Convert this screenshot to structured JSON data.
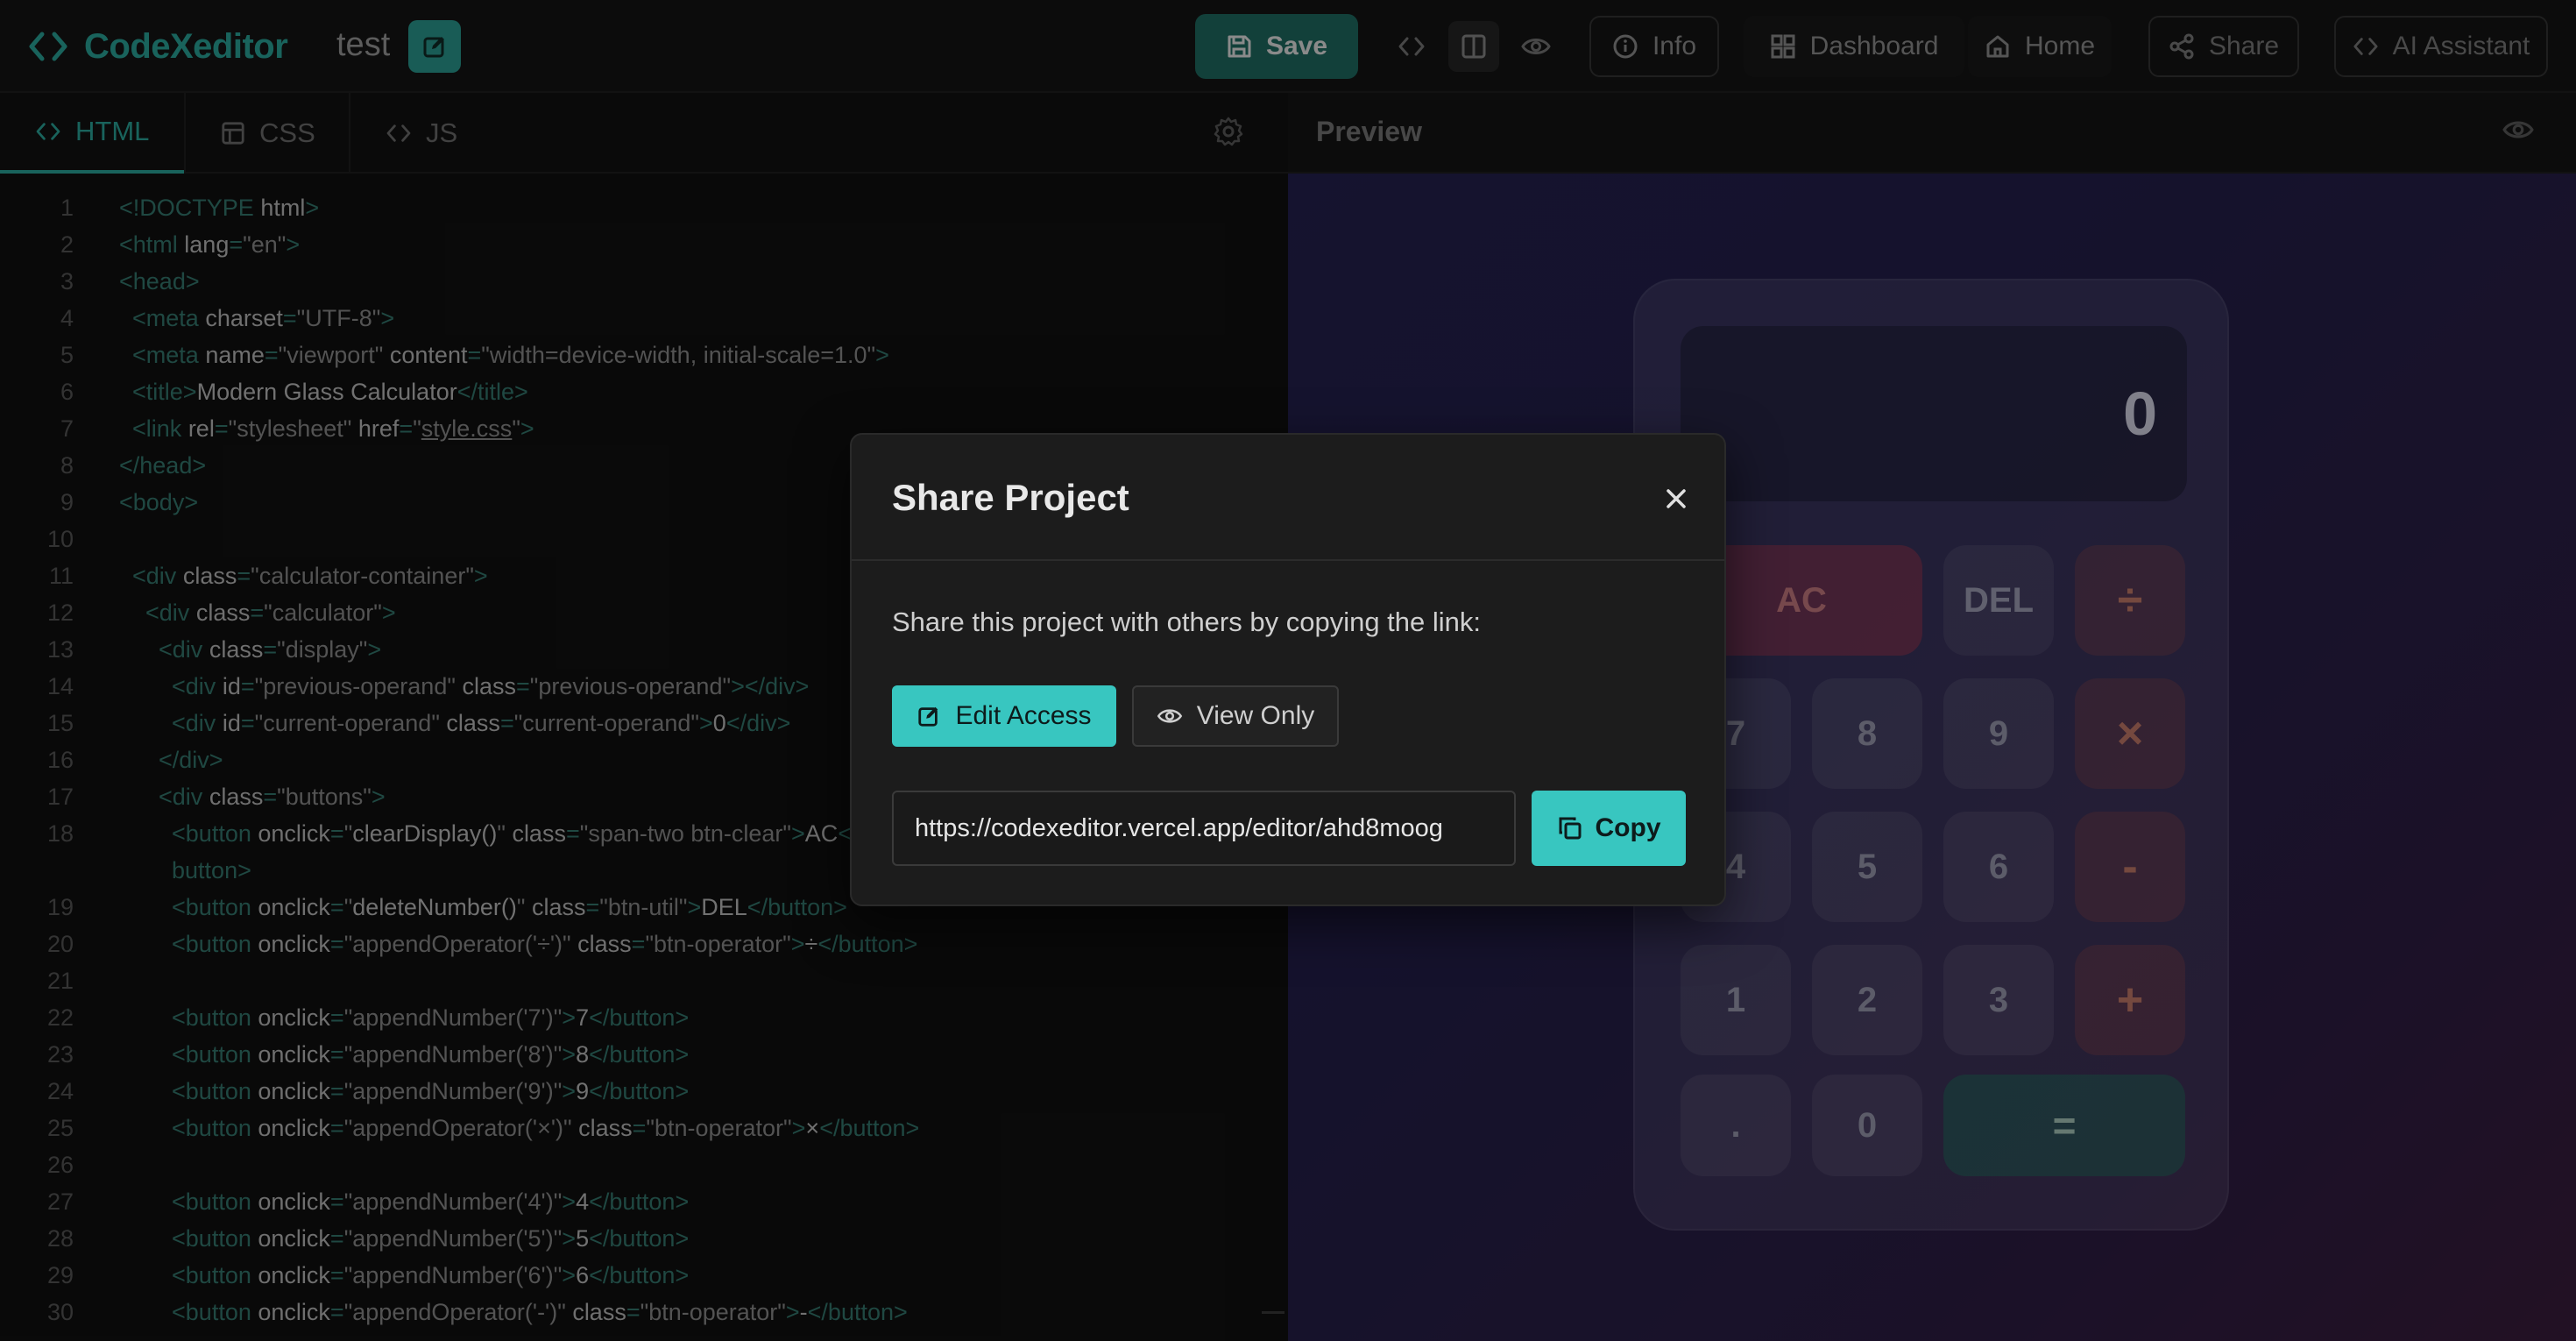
{
  "app": {
    "name": "CodeXeditor",
    "project_name": "test"
  },
  "toolbar": {
    "save_label": "Save",
    "info_label": "Info",
    "dashboard_label": "Dashboard",
    "home_label": "Home",
    "share_label": "Share",
    "ai_label": "AI Assistant"
  },
  "editor": {
    "tabs": [
      {
        "label": "HTML",
        "active": true
      },
      {
        "label": "CSS",
        "active": false
      },
      {
        "label": "JS",
        "active": false
      }
    ],
    "lines": [
      {
        "n": "1",
        "html": "<span class='tg'>&lt;!DOCTYPE</span> <span class='at'>html</span><span class='tg'>&gt;</span>"
      },
      {
        "n": "2",
        "html": "<span class='tg'>&lt;html</span> <span class='at'>lang</span><span class='tg'>=</span><span class='st'>\"en\"</span><span class='tg'>&gt;</span>"
      },
      {
        "n": "3",
        "html": "<span class='tg'>&lt;head&gt;</span>"
      },
      {
        "n": "4",
        "html": "  <span class='tg'>&lt;meta</span> <span class='at'>charset</span><span class='tg'>=</span><span class='st'>\"UTF-8\"</span><span class='tg'>&gt;</span>"
      },
      {
        "n": "5",
        "html": "  <span class='tg'>&lt;meta</span> <span class='at'>name</span><span class='tg'>=</span><span class='st'>\"viewport\"</span> <span class='at'>content</span><span class='tg'>=</span><span class='st'>\"width=device-width, initial-scale=1.0\"</span><span class='tg'>&gt;</span>"
      },
      {
        "n": "6",
        "html": "  <span class='tg'>&lt;title&gt;</span><span class='tx'>Modern Glass Calculator</span><span class='tg'>&lt;/title&gt;</span>"
      },
      {
        "n": "7",
        "html": "  <span class='tg'>&lt;link</span> <span class='at'>rel</span><span class='tg'>=</span><span class='st'>\"stylesheet\"</span> <span class='at'>href</span><span class='tg'>=</span><span class='st'>\"<u>style.css</u>\"</span><span class='tg'>&gt;</span>"
      },
      {
        "n": "8",
        "html": "<span class='tg'>&lt;/head&gt;</span>"
      },
      {
        "n": "9",
        "html": "<span class='tg'>&lt;body&gt;</span>"
      },
      {
        "n": "10",
        "html": ""
      },
      {
        "n": "11",
        "html": "  <span class='tg'>&lt;div</span> <span class='at'>class</span><span class='tg'>=</span><span class='st'>\"calculator-container\"</span><span class='tg'>&gt;</span>"
      },
      {
        "n": "12",
        "html": "    <span class='tg'>&lt;div</span> <span class='at'>class</span><span class='tg'>=</span><span class='st'>\"calculator\"</span><span class='tg'>&gt;</span>"
      },
      {
        "n": "13",
        "html": "      <span class='tg'>&lt;div</span> <span class='at'>class</span><span class='tg'>=</span><span class='st'>\"display\"</span><span class='tg'>&gt;</span>"
      },
      {
        "n": "14",
        "html": "        <span class='tg'>&lt;div</span> <span class='at'>id</span><span class='tg'>=</span><span class='st'>\"previous-operand\"</span> <span class='at'>class</span><span class='tg'>=</span><span class='st'>\"previous-operand\"</span><span class='tg'>&gt;&lt;/div&gt;</span>"
      },
      {
        "n": "15",
        "html": "        <span class='tg'>&lt;div</span> <span class='at'>id</span><span class='tg'>=</span><span class='st'>\"current-operand\"</span> <span class='at'>class</span><span class='tg'>=</span><span class='st'>\"current-operand\"</span><span class='tg'>&gt;</span><span class='tx'>0</span><span class='tg'>&lt;/div&gt;</span>"
      },
      {
        "n": "16",
        "html": "      <span class='tg'>&lt;/div&gt;</span>"
      },
      {
        "n": "17",
        "html": "      <span class='tg'>&lt;div</span> <span class='at'>class</span><span class='tg'>=</span><span class='st'>\"buttons\"</span><span class='tg'>&gt;</span>"
      },
      {
        "n": "18",
        "html": "        <span class='tg'>&lt;button</span> <span class='at'>onclick</span><span class='tg'>=</span><span class='st'>\"</span><span class='tx'>clearDisplay()</span><span class='st'>\"</span> <span class='at'>class</span><span class='tg'>=</span><span class='st'>\"span-two btn-clear\"</span><span class='tg'>&gt;</span><span class='tx'>AC</span><span class='tg'>&lt;/</span>"
      },
      {
        "n": "",
        "html": "        <span class='tg'>button&gt;</span>"
      },
      {
        "n": "19",
        "html": "        <span class='tg'>&lt;button</span> <span class='at'>onclick</span><span class='tg'>=</span><span class='st'>\"</span><span class='tx'>deleteNumber()</span><span class='st'>\"</span> <span class='at'>class</span><span class='tg'>=</span><span class='st'>\"btn-util\"</span><span class='tg'>&gt;</span><span class='tx'>DEL</span><span class='tg'>&lt;/button&gt;</span>"
      },
      {
        "n": "20",
        "html": "        <span class='tg'>&lt;button</span> <span class='at'>onclick</span><span class='tg'>=</span><span class='st'>\"appendOperator('÷')\"</span> <span class='at'>class</span><span class='tg'>=</span><span class='st'>\"btn-operator\"</span><span class='tg'>&gt;</span><span class='tx'>÷</span><span class='tg'>&lt;/button&gt;</span>"
      },
      {
        "n": "21",
        "html": ""
      },
      {
        "n": "22",
        "html": "        <span class='tg'>&lt;button</span> <span class='at'>onclick</span><span class='tg'>=</span><span class='st'>\"appendNumber('7')\"</span><span class='tg'>&gt;</span><span class='tx'>7</span><span class='tg'>&lt;/button&gt;</span>"
      },
      {
        "n": "23",
        "html": "        <span class='tg'>&lt;button</span> <span class='at'>onclick</span><span class='tg'>=</span><span class='st'>\"appendNumber('8')\"</span><span class='tg'>&gt;</span><span class='tx'>8</span><span class='tg'>&lt;/button&gt;</span>"
      },
      {
        "n": "24",
        "html": "        <span class='tg'>&lt;button</span> <span class='at'>onclick</span><span class='tg'>=</span><span class='st'>\"appendNumber('9')\"</span><span class='tg'>&gt;</span><span class='tx'>9</span><span class='tg'>&lt;/button&gt;</span>"
      },
      {
        "n": "25",
        "html": "        <span class='tg'>&lt;button</span> <span class='at'>onclick</span><span class='tg'>=</span><span class='st'>\"appendOperator('×')\"</span> <span class='at'>class</span><span class='tg'>=</span><span class='st'>\"btn-operator\"</span><span class='tg'>&gt;</span><span class='tx'>×</span><span class='tg'>&lt;/button&gt;</span>"
      },
      {
        "n": "26",
        "html": ""
      },
      {
        "n": "27",
        "html": "        <span class='tg'>&lt;button</span> <span class='at'>onclick</span><span class='tg'>=</span><span class='st'>\"appendNumber('4')\"</span><span class='tg'>&gt;</span><span class='tx'>4</span><span class='tg'>&lt;/button&gt;</span>"
      },
      {
        "n": "28",
        "html": "        <span class='tg'>&lt;button</span> <span class='at'>onclick</span><span class='tg'>=</span><span class='st'>\"appendNumber('5')\"</span><span class='tg'>&gt;</span><span class='tx'>5</span><span class='tg'>&lt;/button&gt;</span>"
      },
      {
        "n": "29",
        "html": "        <span class='tg'>&lt;button</span> <span class='at'>onclick</span><span class='tg'>=</span><span class='st'>\"appendNumber('6')\"</span><span class='tg'>&gt;</span><span class='tx'>6</span><span class='tg'>&lt;/button&gt;</span>"
      },
      {
        "n": "30",
        "html": "        <span class='tg'>&lt;button</span> <span class='at'>onclick</span><span class='tg'>=</span><span class='st'>\"appendOperator('-')\"</span> <span class='at'>class</span><span class='tg'>=</span><span class='st'>\"btn-operator\"</span><span class='tg'>&gt;</span><span class='tx'>-</span><span class='tg'>&lt;/button&gt;</span>"
      }
    ]
  },
  "preview": {
    "title": "Preview",
    "display_value": "0",
    "keys": [
      {
        "label": "AC",
        "kind": "ac"
      },
      {
        "label": "DEL",
        "kind": "util"
      },
      {
        "label": "÷",
        "kind": "op"
      },
      {
        "label": "7",
        "kind": "num"
      },
      {
        "label": "8",
        "kind": "num"
      },
      {
        "label": "9",
        "kind": "num"
      },
      {
        "label": "×",
        "kind": "op"
      },
      {
        "label": "4",
        "kind": "num"
      },
      {
        "label": "5",
        "kind": "num"
      },
      {
        "label": "6",
        "kind": "num"
      },
      {
        "label": "-",
        "kind": "op"
      },
      {
        "label": "1",
        "kind": "num"
      },
      {
        "label": "2",
        "kind": "num"
      },
      {
        "label": "3",
        "kind": "num"
      },
      {
        "label": "+",
        "kind": "op"
      },
      {
        "label": ".",
        "kind": "num"
      },
      {
        "label": "0",
        "kind": "num"
      },
      {
        "label": "=",
        "kind": "eq"
      }
    ]
  },
  "modal": {
    "title": "Share Project",
    "description": "Share this project with others by copying the link:",
    "edit_access_label": "Edit Access",
    "view_only_label": "View Only",
    "url": "https://codexeditor.vercel.app/editor/ahd8moog",
    "copy_label": "Copy"
  },
  "colors": {
    "accent": "#2ba59a",
    "accent_bright": "#38c6c0",
    "bg": "#141414"
  }
}
